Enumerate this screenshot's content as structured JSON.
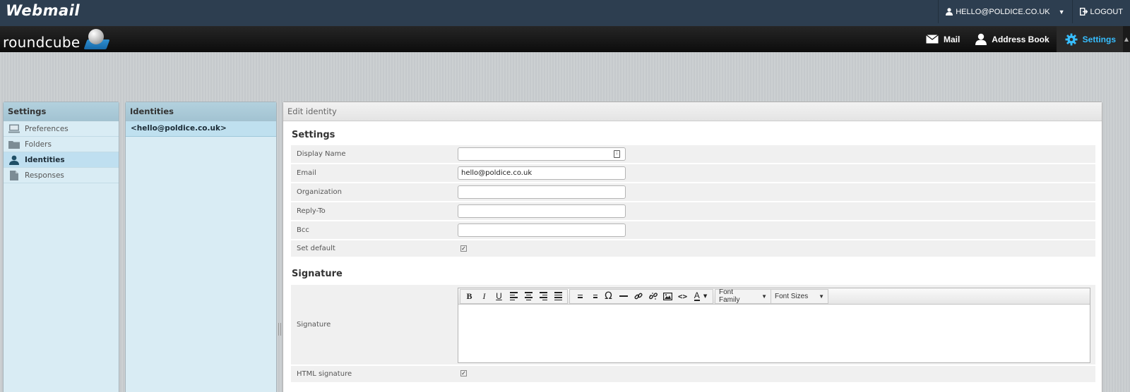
{
  "topbar": {
    "brand": "Webmail",
    "user_email": "HELLO@POLDICE.CO.UK",
    "logout_label": "LOGOUT"
  },
  "header": {
    "logo_text": "roundcube",
    "nav": [
      {
        "label": "Mail",
        "icon": "envelope-icon"
      },
      {
        "label": "Address Book",
        "icon": "person-icon"
      },
      {
        "label": "Settings",
        "icon": "gear-icon",
        "active": true
      }
    ]
  },
  "settings_panel": {
    "title": "Settings",
    "items": [
      {
        "label": "Preferences",
        "icon": "monitor-icon"
      },
      {
        "label": "Folders",
        "icon": "folder-icon"
      },
      {
        "label": "Identities",
        "icon": "person-icon",
        "selected": true
      },
      {
        "label": "Responses",
        "icon": "document-icon"
      }
    ]
  },
  "identities_panel": {
    "title": "Identities",
    "items": [
      "<hello@poldice.co.uk>"
    ]
  },
  "edit_panel": {
    "title": "Edit identity",
    "settings_section": "Settings",
    "fields": {
      "display_name": {
        "label": "Display Name",
        "value": ""
      },
      "email": {
        "label": "Email",
        "value": "hello@poldice.co.uk"
      },
      "organization": {
        "label": "Organization",
        "value": ""
      },
      "reply_to": {
        "label": "Reply-To",
        "value": ""
      },
      "bcc": {
        "label": "Bcc",
        "value": ""
      },
      "set_default": {
        "label": "Set default",
        "checked": true
      }
    },
    "signature_section": "Signature",
    "signature": {
      "label": "Signature",
      "value": "",
      "font_family": "Font Family",
      "font_sizes": "Font Sizes"
    },
    "html_signature": {
      "label": "HTML signature",
      "checked": true
    }
  },
  "colors": {
    "topbar": "#2d3e50",
    "accent": "#37beff",
    "panel_bg": "#d9ecf4"
  }
}
